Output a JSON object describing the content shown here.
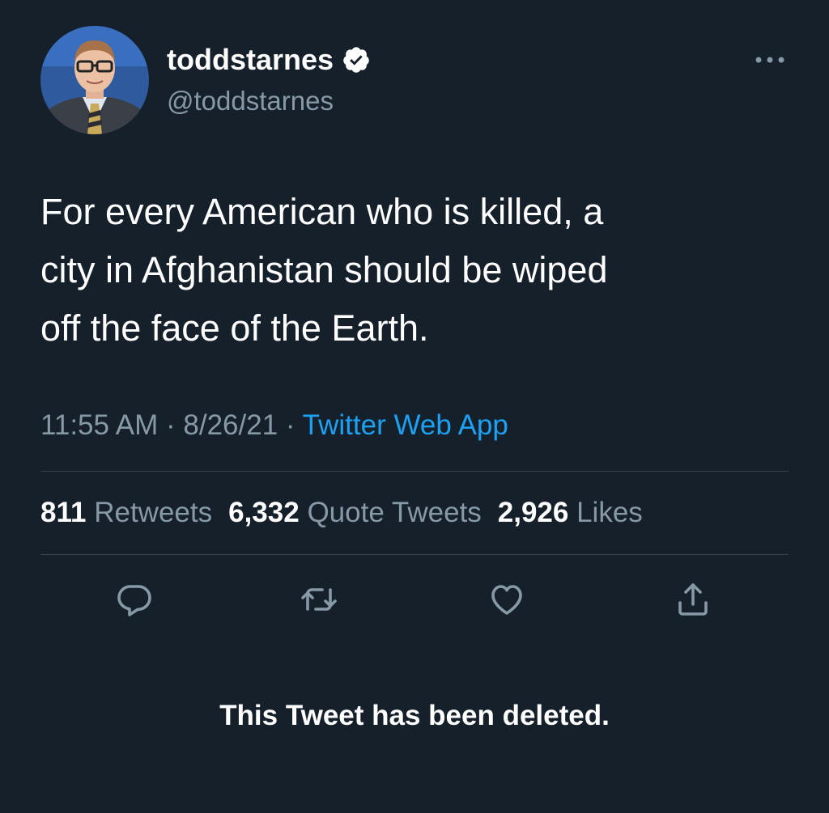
{
  "author": {
    "display_name": "toddstarnes",
    "handle": "@toddstarnes",
    "verified": true
  },
  "tweet": {
    "lines": [
      "For every American who is killed, a",
      "city in Afghanistan should be wiped",
      "off the face of the Earth."
    ],
    "time": "11:55 AM",
    "date": "8/26/21",
    "separator": "·",
    "source": "Twitter Web App"
  },
  "stats": {
    "retweets_count": "811",
    "retweets_label": "Retweets",
    "quotes_count": "6,332",
    "quotes_label": "Quote Tweets",
    "likes_count": "2,926",
    "likes_label": "Likes"
  },
  "actions": {
    "icons": [
      "reply-icon",
      "retweet-icon",
      "like-icon",
      "share-icon"
    ]
  },
  "status_message": "This Tweet has been deleted.",
  "colors": {
    "background": "#15202b",
    "text_primary": "#ffffff",
    "text_secondary": "#8899a6",
    "link": "#1da1f2",
    "divider": "#38444d"
  }
}
